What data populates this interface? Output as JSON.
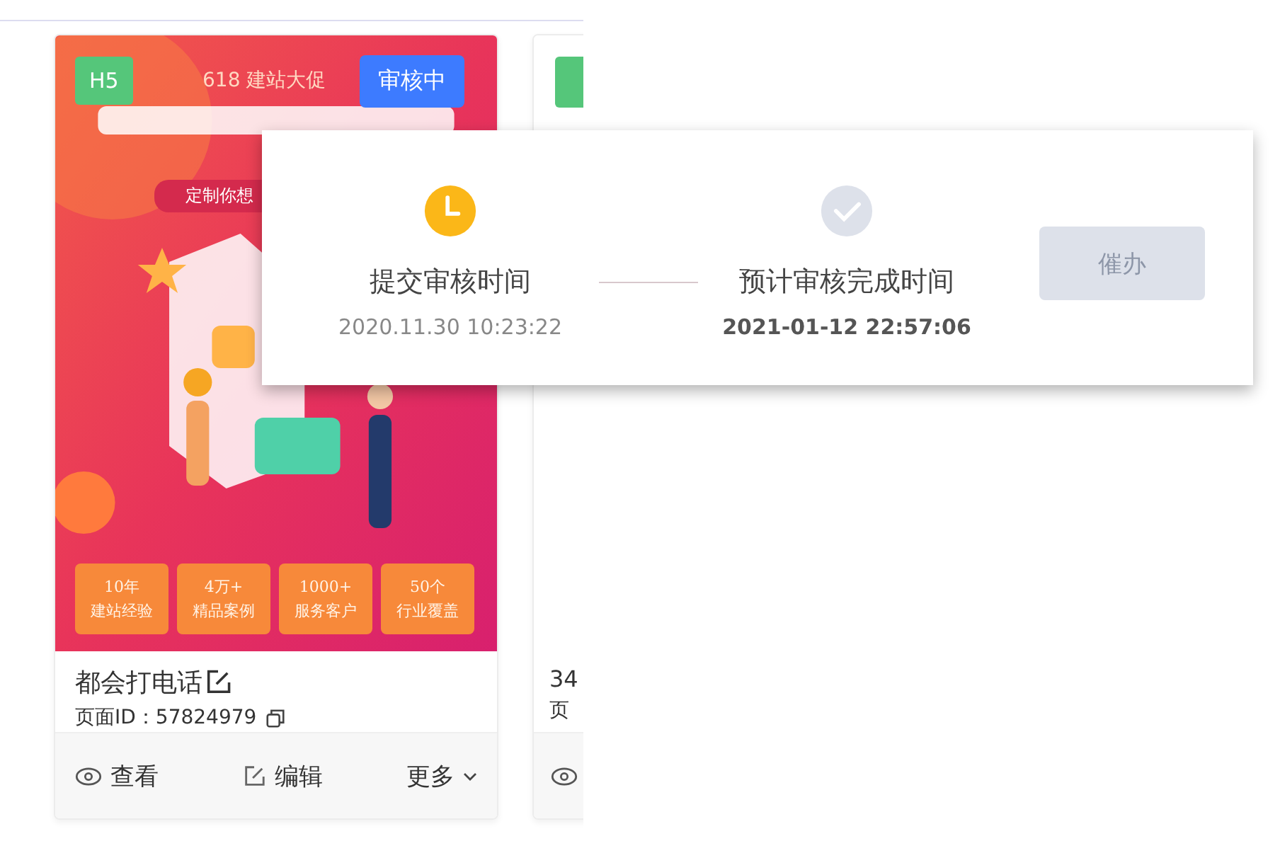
{
  "cards": [
    {
      "type_badge": "H5",
      "status_badge": "审核中",
      "poster": {
        "promo": "618 建站大促",
        "slogan": "定制你想",
        "stats": [
          {
            "value": "10年",
            "label": "建站经验"
          },
          {
            "value": "4万+",
            "label": "精品案例"
          },
          {
            "value": "1000+",
            "label": "服务客户"
          },
          {
            "value": "50个",
            "label": "行业覆盖"
          }
        ]
      },
      "title": "都会打电话",
      "page_id": "页面ID：57824979",
      "actions": [
        {
          "label": "查看",
          "kind": "view"
        },
        {
          "label": "编辑",
          "kind": "edit"
        },
        {
          "label": "更多",
          "kind": "more"
        }
      ]
    },
    {
      "title": "34",
      "page_id": "页",
      "actions": [
        {
          "kind": "view"
        }
      ]
    }
  ],
  "review_popup": {
    "steps": [
      {
        "label": "提交审核时间",
        "time": "2020.11.30 10:23:22",
        "kind": "current"
      },
      {
        "label": "预计审核完成时间",
        "time": "2021-01-12 22:57:06",
        "kind": "pending"
      }
    ],
    "button": {
      "label": "催办",
      "disabled": true
    }
  }
}
